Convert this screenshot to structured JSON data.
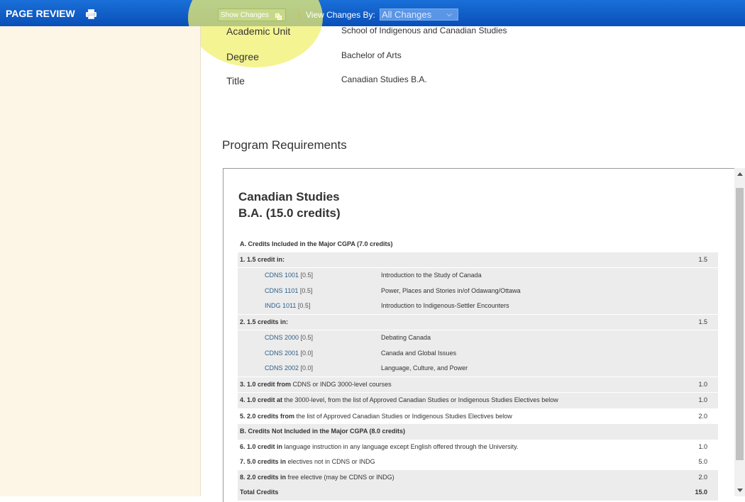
{
  "topbar": {
    "brand": "PAGE REVIEW",
    "show_changes": "Show Changes",
    "separator": "|",
    "view_changes_label": "View Changes By:",
    "view_changes_value": "All Changes"
  },
  "fields": [
    {
      "label": "Academic Unit",
      "value": "School of Indigenous and Canadian Studies"
    },
    {
      "label": "Degree",
      "value": "Bachelor of Arts"
    },
    {
      "label": "Title",
      "value": "Canadian Studies B.A."
    }
  ],
  "section_title": "Program Requirements",
  "program": {
    "title_line1": "Canadian Studies",
    "title_line2": "B.A. (15.0 credits)"
  },
  "requirements": {
    "group_a": "A. Credits Included in the Major CGPA (7.0 credits)",
    "item1": {
      "label": "1. 1.5 credit in:",
      "credits": "1.5"
    },
    "courses1": [
      {
        "code": "CDNS 1001",
        "cr": "[0.5]",
        "title": "Introduction to the Study of Canada"
      },
      {
        "code": "CDNS 1101",
        "cr": "[0.5]",
        "title": "Power, Places and Stories in/of Odawang/Ottawa"
      },
      {
        "code": "INDG 1011",
        "cr": "[0.5]",
        "title": "Introduction to Indigenous-Settler Encounters"
      }
    ],
    "item2": {
      "label": "2. 1.5 credits in:",
      "credits": "1.5"
    },
    "courses2": [
      {
        "code": "CDNS 2000",
        "cr": "[0.5]",
        "title": "Debating Canada"
      },
      {
        "code": "CDNS 2001",
        "cr": "[0.0]",
        "title": "Canada and Global Issues"
      },
      {
        "code": "CDNS 2002",
        "cr": "[0.0]",
        "title": "Language, Culture, and Power"
      }
    ],
    "item3": {
      "bold": "3. 1.0 credit from",
      "rest": " CDNS or INDG 3000-level courses",
      "credits": "1.0"
    },
    "item4": {
      "bold": "4. 1.0 credit at",
      "rest": " the 3000-level, from the list of Approved Canadian Studies or Indigenous Studies Electives below",
      "credits": "1.0"
    },
    "item5": {
      "bold": "5. 2.0 credits from",
      "rest": " the list of Approved Canadian Studies or Indigenous Studies Electives below",
      "credits": "2.0"
    },
    "group_b": "B. Credits Not Included in the Major CGPA (8.0 credits)",
    "item6": {
      "bold": "6. 1.0 credit in",
      "rest": " language instruction in any language except English offered through the University.",
      "credits": "1.0"
    },
    "item7": {
      "bold": "7. 5.0 credits in",
      "rest": " electives not in CDNS or INDG",
      "credits": "5.0"
    },
    "item8": {
      "bold": "8. 2.0 credits in",
      "rest": " free elective (may be CDNS or INDG)",
      "credits": "2.0"
    },
    "total": {
      "label": "Total Credits",
      "credits": "15.0"
    }
  }
}
